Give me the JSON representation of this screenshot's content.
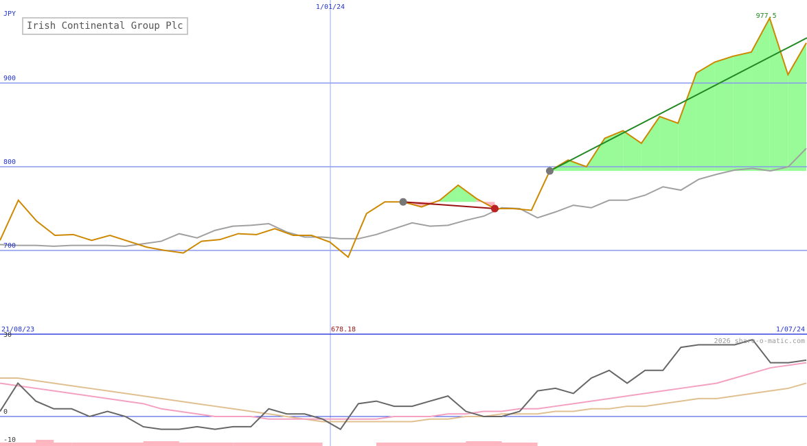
{
  "title": "Irish Continental Group Plc",
  "currency": "JPY",
  "watermark": "2026 share-o-matic.com",
  "colors": {
    "price": "#cc8800",
    "index": "#a0a0a0",
    "grid": "#3344dd",
    "axis_text": "#2233cc",
    "gain_fill": "#98fb98",
    "loss_fill": "#ffb6c1",
    "trend_up": "#228822",
    "trend_down": "#991111",
    "high_label": "#228822",
    "low_label": "#991111",
    "osc": "#666666",
    "osc_ma1": "#f4a0c0",
    "osc_ma2": "#e0c090",
    "hist": "#ffb6c1"
  },
  "chart_data": [
    {
      "type": "line",
      "title": "Irish Continental Group Plc",
      "ylabel": "JPY",
      "ylim": [
        650,
        1000
      ],
      "yticks": [
        700,
        800,
        900
      ],
      "x_start_label": "21/08/23",
      "x_mid_label": "1/01/24",
      "x_end_label": "1/07/24",
      "low_label": "678.18",
      "high_label": "977.5",
      "grid": true,
      "series": [
        {
          "role": "price",
          "values": [
            712,
            760,
            735,
            718,
            719,
            712,
            718,
            711,
            704,
            700,
            697,
            711,
            713,
            720,
            719,
            726,
            718,
            718,
            710,
            692,
            744,
            758,
            758,
            752,
            760,
            778,
            762,
            750,
            750,
            748,
            795,
            808,
            800,
            834,
            843,
            828,
            860,
            852,
            912,
            925,
            932,
            937,
            977.5,
            910,
            948
          ]
        },
        {
          "role": "relative-index",
          "values": [
            707,
            706,
            706,
            705,
            706,
            706,
            706,
            705,
            708,
            711,
            720,
            715,
            724,
            729,
            730,
            732,
            722,
            716,
            716,
            714,
            714,
            719,
            726,
            733,
            729,
            730,
            736,
            741,
            751,
            750,
            739,
            746,
            754,
            751,
            760,
            760,
            766,
            776,
            772,
            785,
            791,
            796,
            798,
            795,
            800,
            822
          ]
        }
      ],
      "trends": [
        {
          "direction": "down",
          "from_value": 758,
          "to_value": 750
        },
        {
          "direction": "up",
          "from_value": 795,
          "to_value": 954
        }
      ]
    },
    {
      "type": "line",
      "ylim": [
        -10,
        30
      ],
      "yticks": [
        -10,
        0,
        30
      ],
      "series": [
        {
          "role": "oscillator",
          "values": [
            2,
            13,
            6,
            3,
            3,
            0,
            2,
            0,
            -4,
            -5,
            -5,
            -4,
            -5,
            -4,
            -4,
            3,
            1,
            1,
            -1,
            -5,
            5,
            6,
            4,
            4,
            6,
            8,
            2,
            0,
            0,
            2,
            10,
            11,
            9,
            15,
            18,
            13,
            18,
            18,
            27,
            28,
            28,
            28,
            30,
            21,
            21,
            22
          ]
        },
        {
          "role": "oscillator-average",
          "values": [
            13,
            12,
            11,
            10,
            9,
            8,
            7,
            6,
            5,
            3,
            2,
            1,
            0,
            0,
            0,
            -1,
            -1,
            -1,
            -1,
            -1,
            -1,
            -1,
            0,
            0,
            0,
            1,
            1,
            2,
            2,
            3,
            3,
            4,
            5,
            6,
            7,
            8,
            9,
            10,
            11,
            12,
            13,
            15,
            17,
            19,
            20,
            21
          ]
        },
        {
          "role": "oscillator-slow-average",
          "values": [
            15,
            15,
            14,
            13,
            12,
            11,
            10,
            9,
            8,
            7,
            6,
            5,
            4,
            3,
            2,
            1,
            0,
            -1,
            -2,
            -2,
            -2,
            -2,
            -2,
            -2,
            -1,
            -1,
            0,
            0,
            1,
            1,
            1,
            2,
            2,
            3,
            3,
            4,
            4,
            5,
            6,
            7,
            7,
            8,
            9,
            10,
            11,
            13
          ]
        }
      ]
    }
  ]
}
